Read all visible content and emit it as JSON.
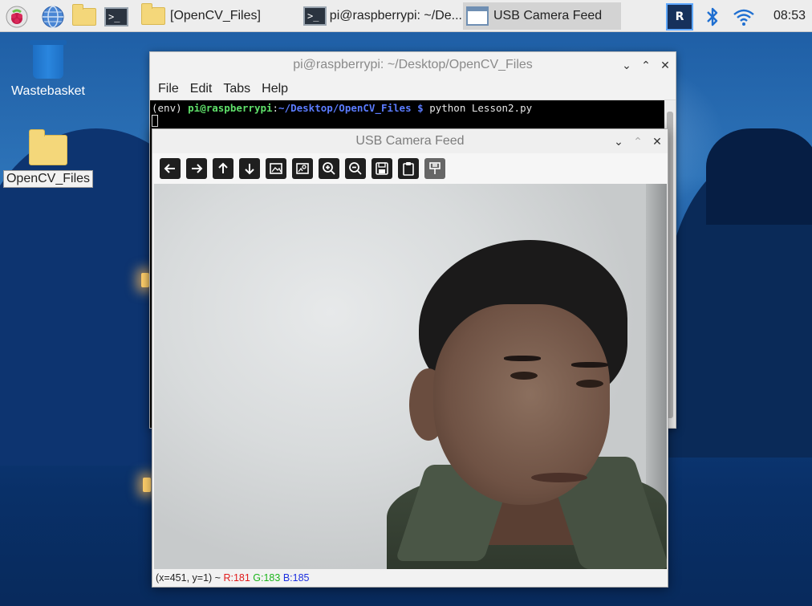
{
  "taskbar": {
    "tasks": [
      {
        "label": "[OpenCV_Files]",
        "icon": "folder-icon"
      },
      {
        "label": "pi@raspberrypi: ~/De...",
        "icon": "terminal-icon"
      },
      {
        "label": "USB Camera Feed",
        "icon": "window-icon"
      }
    ],
    "clock": "08:53"
  },
  "desktop": {
    "items": [
      {
        "label": "Wastebasket",
        "icon": "wastebasket-icon"
      },
      {
        "label": "OpenCV_Files",
        "icon": "folder-icon"
      }
    ]
  },
  "terminal": {
    "title": "pi@raspberrypi: ~/Desktop/OpenCV_Files",
    "menu": [
      "File",
      "Edit",
      "Tabs",
      "Help"
    ],
    "prompt_env": "(env) ",
    "prompt_user": "pi@raspberrypi",
    "prompt_sep": ":",
    "prompt_path": "~/Desktop/OpenCV_Files $",
    "command": " python Lesson2.py"
  },
  "camera": {
    "title": "USB Camera Feed",
    "toolbar": [
      "arrow-left-icon",
      "arrow-right-icon",
      "arrow-up-icon",
      "arrow-down-icon",
      "image-icon",
      "image-settings-icon",
      "zoom-in-icon",
      "zoom-out-icon",
      "save-icon",
      "clipboard-icon",
      "properties-icon"
    ],
    "status_coords": "(x=451, y=1) ~ ",
    "status_r": "R:181",
    "status_g": "G:183",
    "status_b": "B:185"
  },
  "colors": {
    "accent": "#5b7cff",
    "prompt_green": "#5fe06a"
  }
}
